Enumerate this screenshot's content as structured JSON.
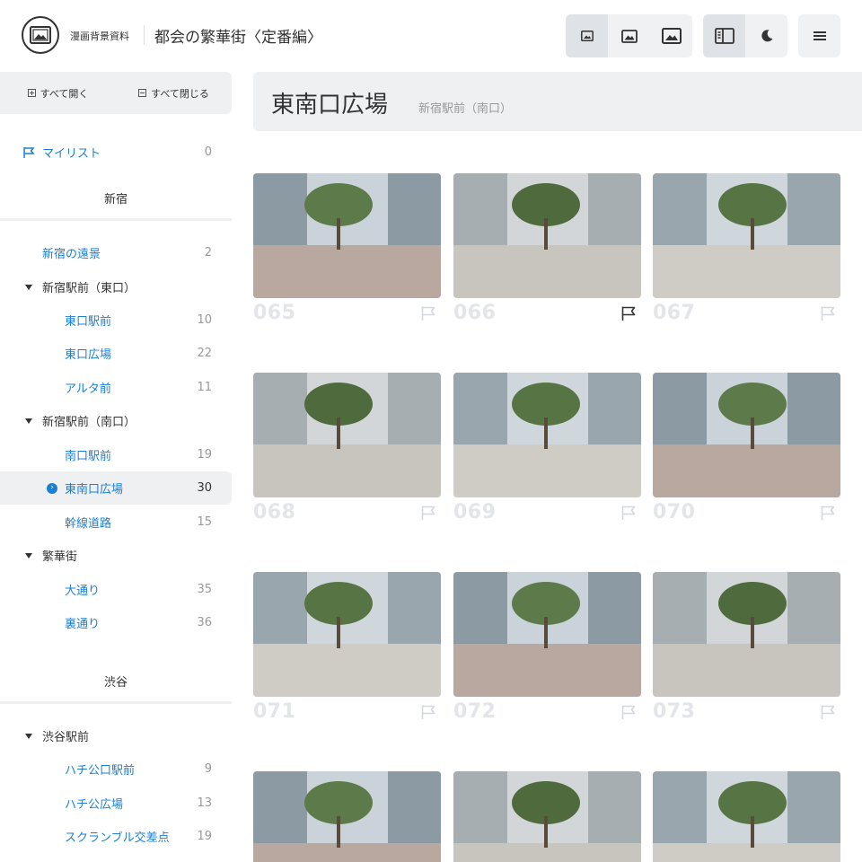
{
  "header": {
    "brand": "漫画背景資料",
    "title": "都会の繁華街〈定番編〉",
    "icons": [
      "image-small-icon",
      "image-medium-icon",
      "image-large-icon",
      "sidebar-toggle-icon",
      "moon-icon",
      "menu-icon"
    ]
  },
  "sidebar": {
    "expand_all": "すべて開く",
    "collapse_all": "すべて閉じる",
    "mylist": {
      "label": "マイリスト",
      "count": "0"
    },
    "sections": [
      {
        "title": "新宿"
      },
      {
        "title": "渋谷"
      }
    ],
    "items": [
      {
        "label": "新宿の遠景",
        "count": "2"
      },
      {
        "label": "新宿駅前（東口）"
      },
      {
        "label": "東口駅前",
        "count": "10"
      },
      {
        "label": "東口広場",
        "count": "22"
      },
      {
        "label": "アルタ前",
        "count": "11"
      },
      {
        "label": "新宿駅前（南口）"
      },
      {
        "label": "南口駅前",
        "count": "19"
      },
      {
        "label": "東南口広場",
        "count": "30"
      },
      {
        "label": "幹線道路",
        "count": "15"
      },
      {
        "label": "繁華街"
      },
      {
        "label": "大通り",
        "count": "35"
      },
      {
        "label": "裏通り",
        "count": "36"
      },
      {
        "label": "渋谷駅前"
      },
      {
        "label": "ハチ公口駅前",
        "count": "9"
      },
      {
        "label": "ハチ公広場",
        "count": "13"
      },
      {
        "label": "スクランブル交差点",
        "count": "19"
      }
    ]
  },
  "main": {
    "title": "東南口広場",
    "subtitle": "新宿駅前（南口）",
    "photos": [
      {
        "number": "065",
        "flagged": false
      },
      {
        "number": "066",
        "flagged": true
      },
      {
        "number": "067",
        "flagged": false
      },
      {
        "number": "068",
        "flagged": false
      },
      {
        "number": "069",
        "flagged": false
      },
      {
        "number": "070",
        "flagged": false
      },
      {
        "number": "071",
        "flagged": false
      },
      {
        "number": "072",
        "flagged": false
      },
      {
        "number": "073",
        "flagged": false
      },
      {
        "number": "",
        "flagged": false
      },
      {
        "number": "",
        "flagged": false
      },
      {
        "number": "",
        "flagged": false
      }
    ]
  },
  "colors": {
    "accent": "#1b7fd4",
    "panel": "#eef0f2",
    "number": "#e3e5e8"
  }
}
